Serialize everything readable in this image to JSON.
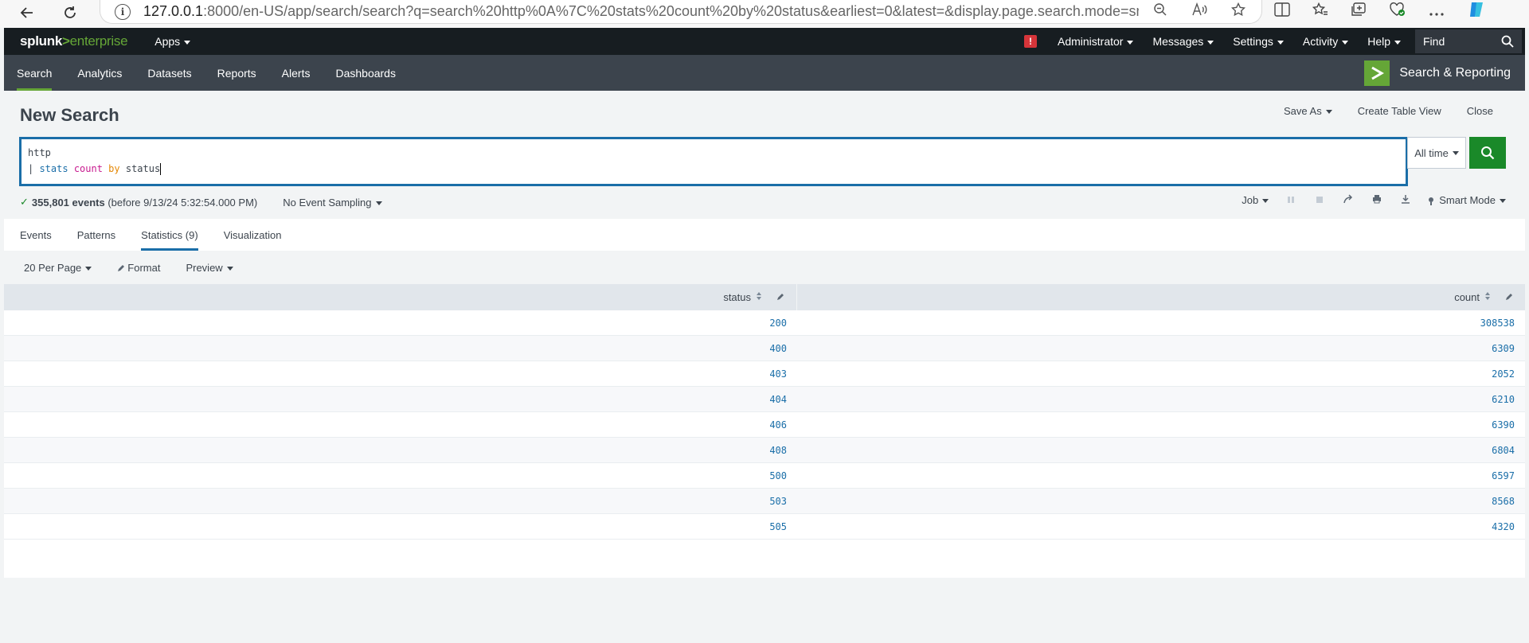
{
  "browser": {
    "url_host": "127.0.0.1",
    "url_rest": ":8000/en-US/app/search/search?q=search%20http%0A%7C%20stats%20count%20by%20status&earliest=0&latest=&display.page.search.mode=sma..."
  },
  "topbar": {
    "logo_main": "splunk",
    "logo_gt": ">",
    "logo_product": "enterprise",
    "apps_label": "Apps",
    "alert_badge": "!",
    "menus": [
      "Administrator",
      "Messages",
      "Settings",
      "Activity",
      "Help"
    ],
    "find_placeholder": "Find"
  },
  "appbar": {
    "tabs": [
      "Search",
      "Analytics",
      "Datasets",
      "Reports",
      "Alerts",
      "Dashboards"
    ],
    "active_tab": "Search",
    "brand_label": "Search & Reporting",
    "brand_glyph": ">"
  },
  "page": {
    "title": "New Search",
    "actions": {
      "save_as": "Save As",
      "create_table_view": "Create Table View",
      "close": "Close"
    }
  },
  "search": {
    "line1": "http",
    "line2_pipe": "| ",
    "line2_cmd": "stats",
    "line2_fn": "count",
    "line2_by": "by",
    "line2_field": "status",
    "time_range": "All time"
  },
  "meta": {
    "check": "✓",
    "events_count": "355,801 events",
    "events_before": "(before 9/13/24 5:32:54.000 PM)",
    "sampling": "No Event Sampling",
    "job_label": "Job",
    "mode_label": "Smart Mode"
  },
  "result_tabs": [
    "Events",
    "Patterns",
    "Statistics (9)",
    "Visualization"
  ],
  "active_result_tab": "Statistics (9)",
  "table_toolbar": {
    "per_page": "20 Per Page",
    "format": "Format",
    "preview": "Preview"
  },
  "table": {
    "columns": [
      "status",
      "count"
    ],
    "rows": [
      [
        "200",
        "308538"
      ],
      [
        "400",
        "6309"
      ],
      [
        "403",
        "2052"
      ],
      [
        "404",
        "6210"
      ],
      [
        "406",
        "6390"
      ],
      [
        "408",
        "6804"
      ],
      [
        "500",
        "6597"
      ],
      [
        "503",
        "8568"
      ],
      [
        "505",
        "4320"
      ]
    ]
  },
  "colors": {
    "accent_green": "#65a637",
    "search_border": "#1a6ea8",
    "search_button": "#1a8929",
    "topbar_bg": "#171d21",
    "appbar_bg": "#3c444d",
    "link_blue": "#1a6ea8"
  }
}
